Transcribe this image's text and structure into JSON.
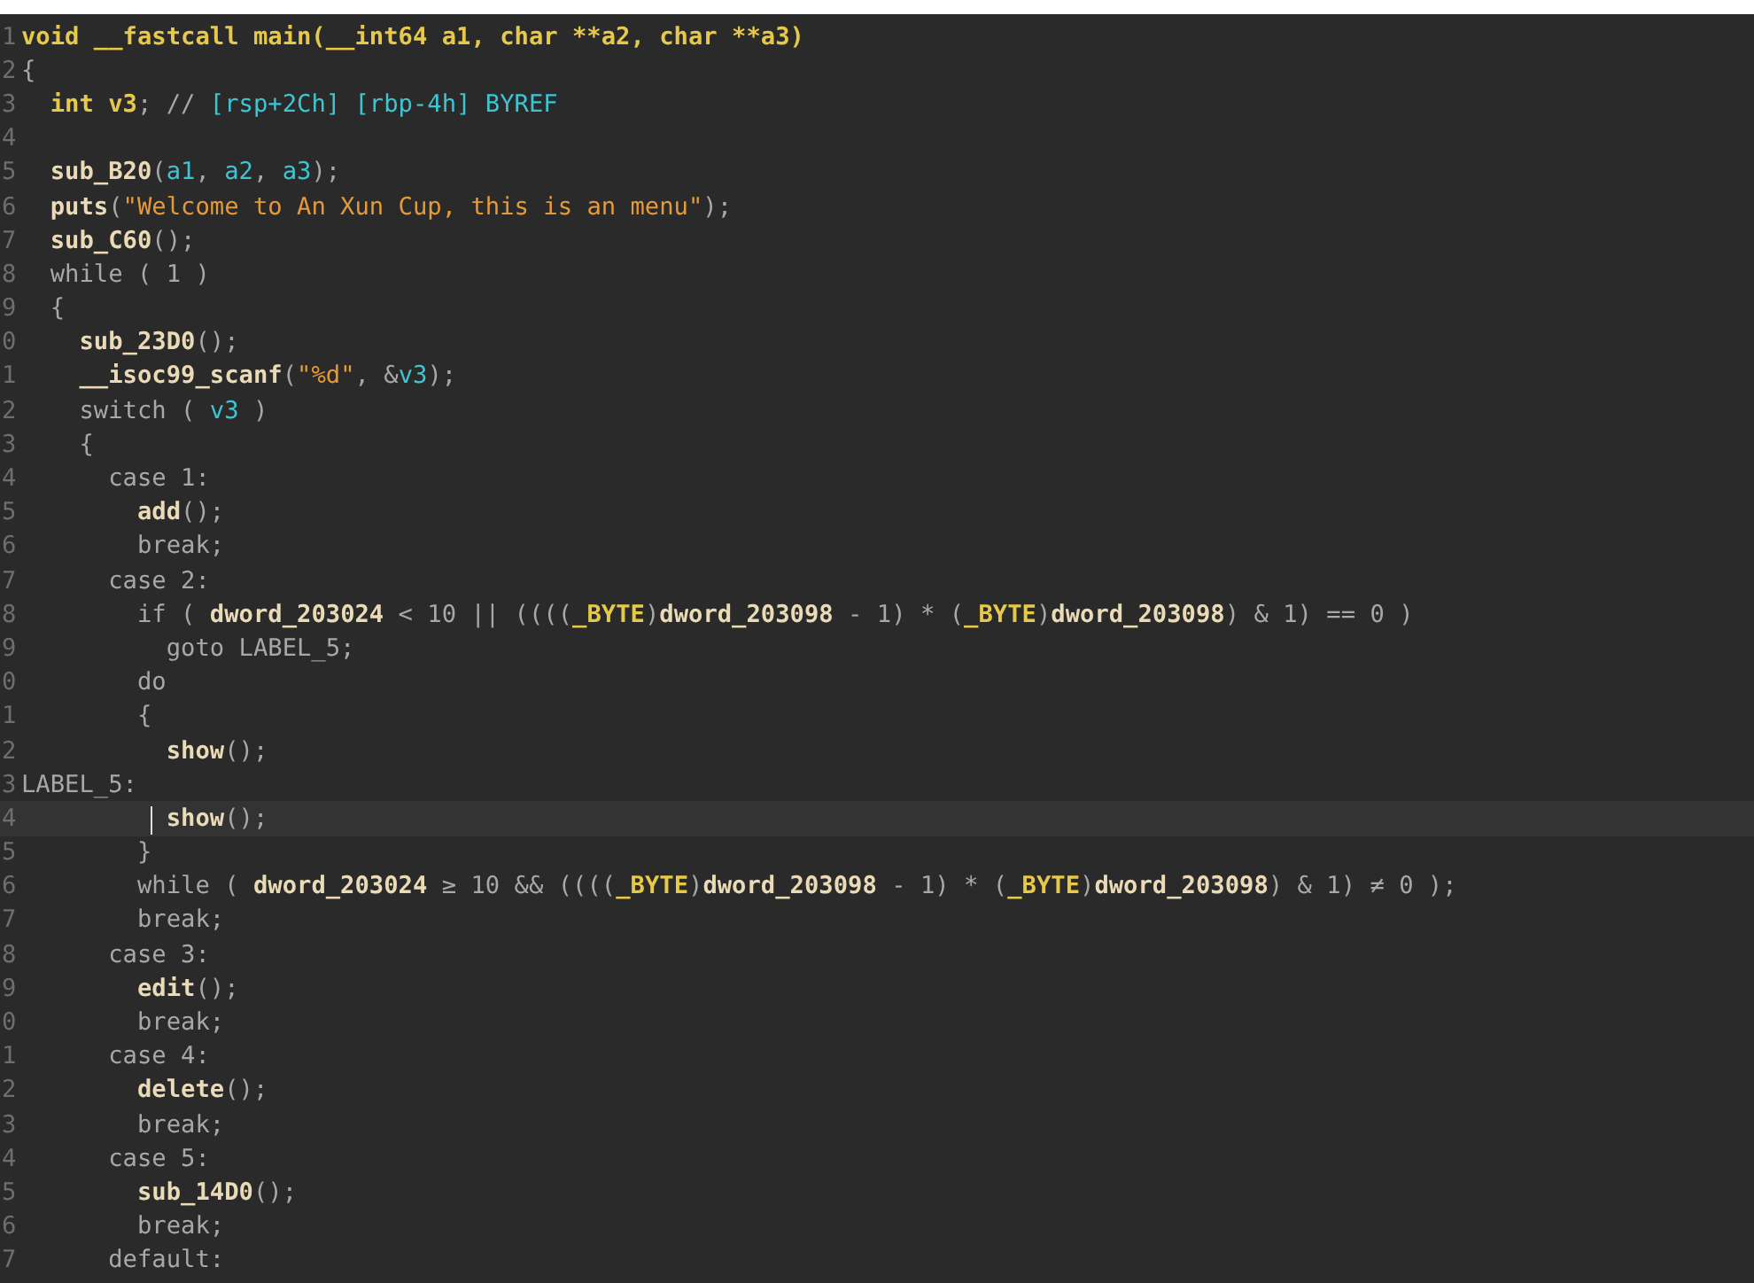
{
  "editor": {
    "lines": [
      {
        "number": "1",
        "current": false,
        "tokens": [
          {
            "kind": "type",
            "text": "void __fastcall main(__int64 a1, char **a2, char **a3)"
          }
        ]
      },
      {
        "number": "2",
        "current": false,
        "tokens": [
          {
            "kind": "plain",
            "text": "{"
          }
        ]
      },
      {
        "number": "3",
        "current": false,
        "tokens": [
          {
            "kind": "type",
            "text": "  int v3"
          },
          {
            "kind": "plain",
            "text": "; // "
          },
          {
            "kind": "comment",
            "text": "[rsp+2Ch] [rbp-4h] BYREF"
          }
        ]
      },
      {
        "number": "4",
        "current": false
      },
      {
        "number": "5",
        "current": false,
        "tokens": [
          {
            "kind": "func",
            "text": "  sub_B20"
          },
          {
            "kind": "plain",
            "text": "("
          },
          {
            "kind": "var",
            "text": "a1"
          },
          {
            "kind": "plain",
            "text": ", "
          },
          {
            "kind": "var",
            "text": "a2"
          },
          {
            "kind": "plain",
            "text": ", "
          },
          {
            "kind": "var",
            "text": "a3"
          },
          {
            "kind": "plain",
            "text": ");"
          }
        ]
      },
      {
        "number": "6",
        "current": false,
        "tokens": [
          {
            "kind": "func",
            "text": "  puts"
          },
          {
            "kind": "plain",
            "text": "("
          },
          {
            "kind": "string",
            "text": "\"Welcome to An Xun Cup, this is an menu\""
          },
          {
            "kind": "plain",
            "text": ");"
          }
        ]
      },
      {
        "number": "7",
        "current": false,
        "tokens": [
          {
            "kind": "func",
            "text": "  sub_C60"
          },
          {
            "kind": "plain",
            "text": "();"
          }
        ]
      },
      {
        "number": "8",
        "current": false,
        "tokens": [
          {
            "kind": "plain",
            "text": "  while ( 1 )"
          }
        ]
      },
      {
        "number": "9",
        "current": false,
        "tokens": [
          {
            "kind": "plain",
            "text": "  {"
          }
        ]
      },
      {
        "number": "0",
        "current": false,
        "tokens": [
          {
            "kind": "func",
            "text": "    sub_23D0"
          },
          {
            "kind": "plain",
            "text": "();"
          }
        ]
      },
      {
        "number": "1",
        "current": false,
        "tokens": [
          {
            "kind": "func",
            "text": "    __isoc99_scanf"
          },
          {
            "kind": "plain",
            "text": "("
          },
          {
            "kind": "string",
            "text": "\"%d\""
          },
          {
            "kind": "plain",
            "text": ", &"
          },
          {
            "kind": "var",
            "text": "v3"
          },
          {
            "kind": "plain",
            "text": ");"
          }
        ]
      },
      {
        "number": "2",
        "current": false,
        "tokens": [
          {
            "kind": "plain",
            "text": "    switch ( "
          },
          {
            "kind": "var",
            "text": "v3"
          },
          {
            "kind": "plain",
            "text": " )"
          }
        ]
      },
      {
        "number": "3",
        "current": false,
        "tokens": [
          {
            "kind": "plain",
            "text": "    {"
          }
        ]
      },
      {
        "number": "4",
        "current": false,
        "tokens": [
          {
            "kind": "plain",
            "text": "      case 1:"
          }
        ]
      },
      {
        "number": "5",
        "current": false,
        "tokens": [
          {
            "kind": "func",
            "text": "        add"
          },
          {
            "kind": "plain",
            "text": "();"
          }
        ]
      },
      {
        "number": "6",
        "current": false,
        "tokens": [
          {
            "kind": "plain",
            "text": "        break;"
          }
        ]
      },
      {
        "number": "7",
        "current": false,
        "tokens": [
          {
            "kind": "plain",
            "text": "      case 2:"
          }
        ]
      },
      {
        "number": "8",
        "current": false,
        "tokens": [
          {
            "kind": "plain",
            "text": "        if ( "
          },
          {
            "kind": "func",
            "text": "dword_203024"
          },
          {
            "kind": "plain",
            "text": " < 10 || (((("
          },
          {
            "kind": "type",
            "text": "_BYTE"
          },
          {
            "kind": "plain",
            "text": ")"
          },
          {
            "kind": "func",
            "text": "dword_203098"
          },
          {
            "kind": "plain",
            "text": " - 1) * ("
          },
          {
            "kind": "type",
            "text": "_BYTE"
          },
          {
            "kind": "plain",
            "text": ")"
          },
          {
            "kind": "func",
            "text": "dword_203098"
          },
          {
            "kind": "plain",
            "text": ") & 1) == 0 )"
          }
        ]
      },
      {
        "number": "9",
        "current": false,
        "tokens": [
          {
            "kind": "plain",
            "text": "          goto LABEL_5;"
          }
        ]
      },
      {
        "number": "0",
        "current": false,
        "tokens": [
          {
            "kind": "plain",
            "text": "        do"
          }
        ]
      },
      {
        "number": "1",
        "current": false,
        "tokens": [
          {
            "kind": "plain",
            "text": "        {"
          }
        ]
      },
      {
        "number": "2",
        "current": false,
        "tokens": [
          {
            "kind": "func",
            "text": "          show"
          },
          {
            "kind": "plain",
            "text": "();"
          }
        ]
      },
      {
        "number": "3",
        "current": false,
        "tokens": [
          {
            "kind": "plain",
            "text": "LABEL_5:"
          }
        ]
      },
      {
        "number": "4",
        "current": true,
        "tokens": [
          {
            "kind": "func",
            "text": "          show"
          },
          {
            "kind": "plain",
            "text": "();"
          }
        ]
      },
      {
        "number": "5",
        "current": false,
        "tokens": [
          {
            "kind": "plain",
            "text": "        }"
          }
        ]
      },
      {
        "number": "6",
        "current": false,
        "tokens": [
          {
            "kind": "plain",
            "text": "        while ( "
          },
          {
            "kind": "func",
            "text": "dword_203024"
          },
          {
            "kind": "plain",
            "text": " ≥ 10 && (((("
          },
          {
            "kind": "type",
            "text": "_BYTE"
          },
          {
            "kind": "plain",
            "text": ")"
          },
          {
            "kind": "func",
            "text": "dword_203098"
          },
          {
            "kind": "plain",
            "text": " - 1) * ("
          },
          {
            "kind": "type",
            "text": "_BYTE"
          },
          {
            "kind": "plain",
            "text": ")"
          },
          {
            "kind": "func",
            "text": "dword_203098"
          },
          {
            "kind": "plain",
            "text": ") & 1) ≠ 0 );"
          }
        ]
      },
      {
        "number": "7",
        "current": false,
        "tokens": [
          {
            "kind": "plain",
            "text": "        break;"
          }
        ]
      },
      {
        "number": "8",
        "current": false,
        "tokens": [
          {
            "kind": "plain",
            "text": "      case 3:"
          }
        ]
      },
      {
        "number": "9",
        "current": false,
        "tokens": [
          {
            "kind": "func",
            "text": "        edit"
          },
          {
            "kind": "plain",
            "text": "();"
          }
        ]
      },
      {
        "number": "0",
        "current": false,
        "tokens": [
          {
            "kind": "plain",
            "text": "        break;"
          }
        ]
      },
      {
        "number": "1",
        "current": false,
        "tokens": [
          {
            "kind": "plain",
            "text": "      case 4:"
          }
        ]
      },
      {
        "number": "2",
        "current": false,
        "tokens": [
          {
            "kind": "func",
            "text": "        delete"
          },
          {
            "kind": "plain",
            "text": "();"
          }
        ]
      },
      {
        "number": "3",
        "current": false,
        "tokens": [
          {
            "kind": "plain",
            "text": "        break;"
          }
        ]
      },
      {
        "number": "4",
        "current": false,
        "tokens": [
          {
            "kind": "plain",
            "text": "      case 5:"
          }
        ]
      },
      {
        "number": "5",
        "current": false,
        "tokens": [
          {
            "kind": "func",
            "text": "        sub_14D0"
          },
          {
            "kind": "plain",
            "text": "();"
          }
        ]
      },
      {
        "number": "6",
        "current": false,
        "tokens": [
          {
            "kind": "plain",
            "text": "        break;"
          }
        ]
      },
      {
        "number": "7",
        "current": false,
        "tokens": [
          {
            "kind": "plain",
            "text": "      default:"
          }
        ]
      }
    ]
  }
}
